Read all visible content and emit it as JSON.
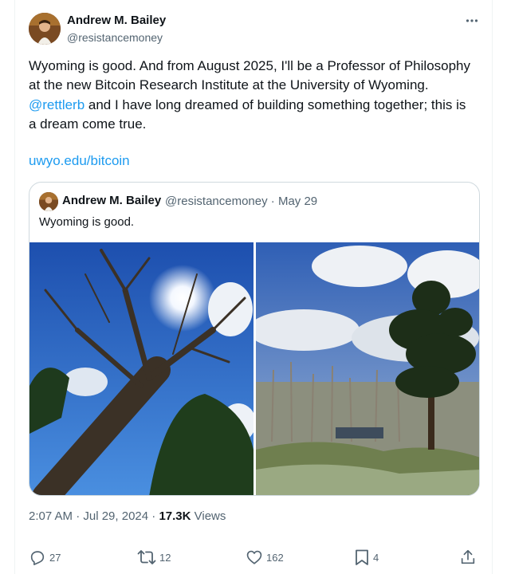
{
  "author": {
    "name": "Andrew M. Bailey",
    "handle": "@resistancemoney"
  },
  "tweet": {
    "text_part1": "Wyoming is good. And from August 2025, I'll be a Professor of Philosophy at the new Bitcoin Research Institute at the University of Wyoming. ",
    "mention": "@rettlerb",
    "text_part2": " and I have long dreamed of building something together; this is a dream come true.",
    "link": "uwyo.edu/bitcoin"
  },
  "quote": {
    "name": "Andrew M. Bailey",
    "meta": "@resistancemoney · May 29",
    "text": "Wyoming is good.",
    "images": [
      "photo of a tall tree against a blue sky with sun",
      "photo of pine trees and a pond under cloudy sky"
    ]
  },
  "timestamp": {
    "time_date": "2:07 AM · Jul 29, 2024 · ",
    "views_count": "17.3K",
    "views_label": " Views"
  },
  "actions": {
    "replies": "27",
    "reposts": "12",
    "likes": "162",
    "bookmarks": "4"
  },
  "icons": [
    "more-icon",
    "reply-icon",
    "repost-icon",
    "like-icon",
    "bookmark-icon",
    "share-icon"
  ],
  "colors": {
    "accent": "#1d9bf0",
    "secondary_text": "#536471",
    "border": "#cfd9de"
  }
}
